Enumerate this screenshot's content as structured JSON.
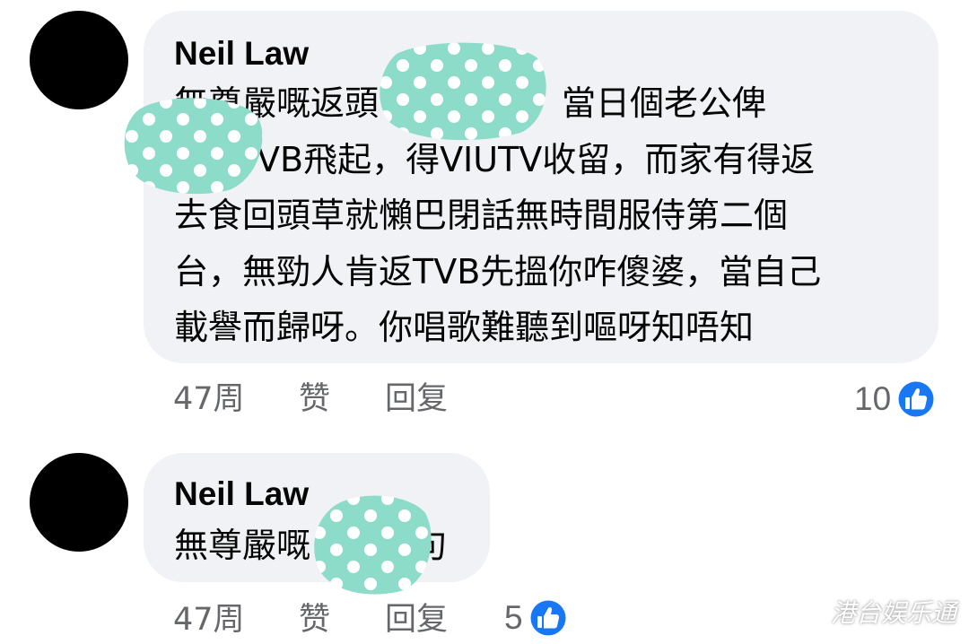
{
  "colors": {
    "bubble": "#f0f2f5",
    "meta_text": "#65676b",
    "like_blue": "#1877f2",
    "blot_teal": "#8ddbc9"
  },
  "comments": [
    {
      "author": "Neil Law",
      "lines": [
        "無尊嚴嘅返頭",
        "VB飛起，得VIUTV收留，而家有得返",
        "去食回頭草就懶巴閉話無時間服侍第二個",
        "台，無勁人肯返TVB先搵你咋傻婆，當自己",
        "載譽而歸呀。你唱歌難聽到嘔呀知唔知"
      ],
      "line1_tail": "當日個老公俾",
      "time": "47周",
      "like_label": "赞",
      "reply_label": "回复",
      "reaction_count": "10",
      "reaction_icon": "thumbs-up-icon"
    },
    {
      "author": "Neil Law",
      "lines": [
        "無尊嚴嘅"
      ],
      "line1_tail": "句",
      "time": "47周",
      "like_label": "赞",
      "reply_label": "回复",
      "reaction_count": "5",
      "reaction_icon": "thumbs-up-icon"
    }
  ],
  "watermark": "港台娱乐通"
}
